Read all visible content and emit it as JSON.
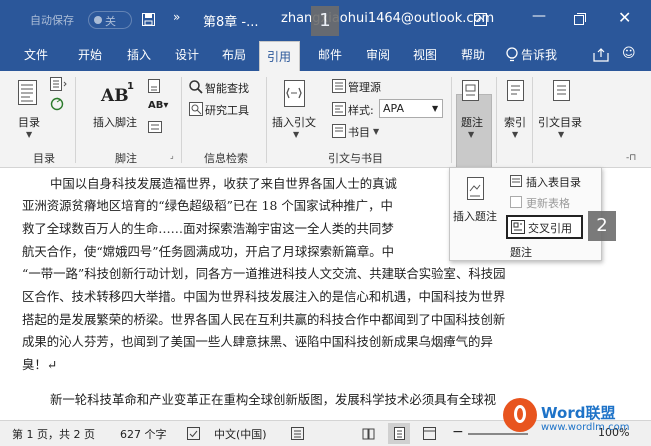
{
  "title_bar": {
    "autosave_label": "自动保存",
    "autosave_state": "关",
    "doc_name": "第8章 -...",
    "account": "zhangxiaohui1464@outlook.com"
  },
  "tabs": [
    "文件",
    "开始",
    "插入",
    "设计",
    "布局",
    "引用",
    "邮件",
    "审阅",
    "视图",
    "帮助",
    "告诉我"
  ],
  "active_tab": "引用",
  "ribbon": {
    "toc": {
      "button": "目录",
      "group": "目录"
    },
    "footnote": {
      "button": "插入脚注",
      "ab": "AB",
      "sup": "1",
      "group": "脚注"
    },
    "research": {
      "smart": "智能查找",
      "researcher": "研究工具",
      "group": "信息检索"
    },
    "citations": {
      "insert": "插入引文",
      "manage": "管理源",
      "style_label": "样式:",
      "style_value": "APA",
      "bibliography": "书目",
      "group": "引文与书目"
    },
    "captions": {
      "button": "题注"
    },
    "index": {
      "button": "索引"
    },
    "toa": {
      "button": "引文目录"
    }
  },
  "popup": {
    "insert_caption": "插入题注",
    "insert_tof": "插入表目录",
    "update_table": "更新表格",
    "cross_ref": "交叉引用",
    "group": "题注"
  },
  "callouts": {
    "one": "1",
    "two": "2"
  },
  "document": {
    "lines": [
      "中国以自身科技发展造福世界，收获了来自世界各国人士的真诚",
      "亚洲资源贫瘠地区培育的“绿色超级稻”已在 18 个国家试种推广，中",
      "救了全球数百万人的生命……面对探索浩瀚宇宙这一全人类的共同梦",
      "航天合作，使“嫦娥四号”任务圆满成功，开启了月球探索新篇章。中",
      "“一带一路”科技创新行动计划，同各方一道推进科技人文交流、共建联合实验室、科技园",
      "区合作、技术转移四大举措。中国为世界科技发展注入的是信心和机遇，中国科技为世界",
      "搭起的是发展繁荣的桥梁。世界各国人民在互利共赢的科技合作中都闻到了中国科技创新",
      "成果的沁人芬芳，也闻到了美国一些人肆意抹黑、诬陷中国科技创新成果乌烟瘴气的异",
      "臭！↵",
      "新一轮科技革命和产业变革正在重构全球创新版图，发展科学技术必须具有全球视"
    ]
  },
  "status": {
    "page": "第 1 页，共 2 页",
    "words": "627 个字",
    "lang": "中文(中国)",
    "zoom": "100%"
  },
  "watermark": {
    "brand": "Word联盟",
    "url": "www.wordlm.com"
  }
}
